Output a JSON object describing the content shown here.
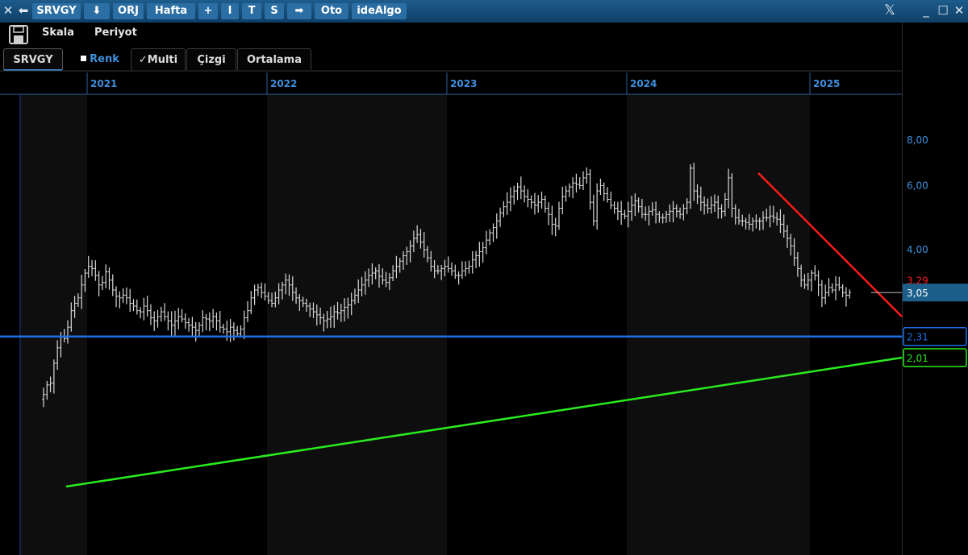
{
  "titlebar": {
    "close_glyph": "✕",
    "back_glyph": "⬅",
    "symbol": "SRVGY",
    "down_glyph": "⬇",
    "orj": "ORJ",
    "period": "Hafta",
    "plus": "+",
    "i": "I",
    "t": "T",
    "s": "S",
    "arrow": "➡",
    "oto": "Oto",
    "brand": "ideAlgo",
    "x_logo": "𝕏",
    "minimize": "_",
    "maximize": "☐",
    "close": "✕"
  },
  "toolbar": {
    "scale": "Skala",
    "period": "Periyot"
  },
  "tabs": {
    "symbol": "SRVGY",
    "color": "Renk",
    "multi": "Multi",
    "line": "Çizgi",
    "average": "Ortalama"
  },
  "colors": {
    "bars": "#d9d9d9",
    "support_line": "#2aeb1f",
    "resistance_line": "#ff1a1a",
    "horizontal_line": "#1e6fe6",
    "axis_text": "#3f8fdc"
  },
  "chart_data": {
    "type": "ohlc",
    "timeframe": "weekly",
    "x_labels": [
      "2021",
      "2022",
      "2023",
      "2024",
      "2025"
    ],
    "y_ticks": [
      "8,00",
      "6,00",
      "4,00"
    ],
    "y_scale": "log",
    "ylim": [
      1.55,
      8.5
    ],
    "price_badges": {
      "resistance": "3,29",
      "last": "3,05",
      "horizontal": "2,31",
      "support": "2,01"
    },
    "series_weekly_closes": [
      1.6,
      1.7,
      1.72,
      1.95,
      2.15,
      2.3,
      2.28,
      2.45,
      2.72,
      2.85,
      2.95,
      3.2,
      3.45,
      3.6,
      3.55,
      3.4,
      3.2,
      3.25,
      3.48,
      3.3,
      3.1,
      2.98,
      2.95,
      3.0,
      2.95,
      2.85,
      2.8,
      2.72,
      2.7,
      2.8,
      2.72,
      2.6,
      2.55,
      2.62,
      2.7,
      2.62,
      2.55,
      2.48,
      2.55,
      2.62,
      2.58,
      2.52,
      2.48,
      2.45,
      2.4,
      2.48,
      2.6,
      2.58,
      2.55,
      2.62,
      2.55,
      2.45,
      2.42,
      2.38,
      2.45,
      2.4,
      2.35,
      2.42,
      2.6,
      2.72,
      2.95,
      3.1,
      3.15,
      3.05,
      2.98,
      2.9,
      2.85,
      2.95,
      3.1,
      3.2,
      3.3,
      3.2,
      3.05,
      2.95,
      2.9,
      2.85,
      2.8,
      2.75,
      2.7,
      2.65,
      2.6,
      2.55,
      2.58,
      2.62,
      2.7,
      2.68,
      2.72,
      2.78,
      2.82,
      2.9,
      3.0,
      3.1,
      3.2,
      3.3,
      3.4,
      3.45,
      3.5,
      3.38,
      3.3,
      3.25,
      3.35,
      3.5,
      3.6,
      3.72,
      3.85,
      3.95,
      4.1,
      4.3,
      4.4,
      4.2,
      4.0,
      3.8,
      3.6,
      3.5,
      3.5,
      3.55,
      3.6,
      3.55,
      3.5,
      3.4,
      3.4,
      3.5,
      3.55,
      3.6,
      3.75,
      3.85,
      3.95,
      4.05,
      4.25,
      4.45,
      4.6,
      4.8,
      5.05,
      5.25,
      5.4,
      5.6,
      5.8,
      5.95,
      5.8,
      5.6,
      5.5,
      5.4,
      5.3,
      5.4,
      5.5,
      5.2,
      5.0,
      4.7,
      4.65,
      5.2,
      5.6,
      5.8,
      5.95,
      6.1,
      6.05,
      6.0,
      6.3,
      6.45,
      5.4,
      4.8,
      5.8,
      6.0,
      5.7,
      5.5,
      5.3,
      5.2,
      5.1,
      5.0,
      4.95,
      5.1,
      5.3,
      5.45,
      5.25,
      5.0,
      5.0,
      5.1,
      5.15,
      5.0,
      4.9,
      4.9,
      5.0,
      5.1,
      5.2,
      5.1,
      5.0,
      5.2,
      5.4,
      6.7,
      5.8,
      5.6,
      5.4,
      5.3,
      5.2,
      5.3,
      5.4,
      5.2,
      5.1,
      5.5,
      6.3,
      5.2,
      4.9,
      4.8,
      4.8,
      4.75,
      4.7,
      4.8,
      4.8,
      4.8,
      4.9,
      4.9,
      4.95,
      4.9,
      4.85,
      4.7,
      4.5,
      4.3,
      4.1,
      3.8,
      3.55,
      3.3,
      3.2,
      3.3,
      3.45,
      3.4,
      3.2,
      2.95,
      3.05,
      3.15,
      3.1,
      3.2,
      3.15,
      3.05,
      3.0,
      3.05
    ]
  }
}
